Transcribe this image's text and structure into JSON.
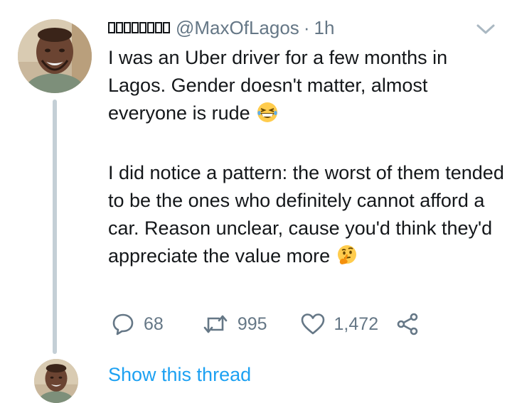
{
  "tweet": {
    "display_name_glyph_count": 8,
    "handle": "@MaxOfLagos",
    "separator": "·",
    "time": "1h",
    "text_paragraph_1": "I was an Uber driver for a few months in Lagos. Gender doesn't matter, almost everyone is rude",
    "text_paragraph_2": "I did notice a pattern: the worst of them tended to be the ones who definitely cannot afford a car. Reason unclear, cause you'd think they'd appreciate the value more",
    "emoji_1": "grinning-squinting-face-icon",
    "emoji_2": "thinking-face-icon"
  },
  "actions": {
    "replies": "68",
    "retweets": "995",
    "likes": "1,472"
  },
  "thread": {
    "show_label": "Show this thread"
  },
  "colors": {
    "text": "#14171a",
    "secondary": "#657786",
    "link": "#1da1f2",
    "thread_line": "#c4cfd6"
  }
}
